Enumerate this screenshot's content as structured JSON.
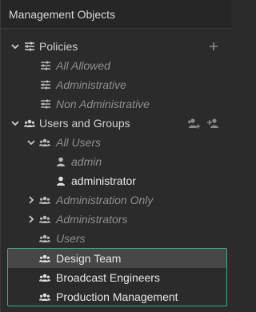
{
  "panel": {
    "title": "Management Objects"
  },
  "tree": {
    "policies": {
      "label": "Policies",
      "icon": "sliders-icon",
      "expanded": true,
      "add_action_icon": "plus-icon",
      "children": [
        {
          "label": "All Allowed",
          "icon": "sliders-icon"
        },
        {
          "label": "Administrative",
          "icon": "sliders-icon"
        },
        {
          "label": "Non Administrative",
          "icon": "sliders-icon"
        }
      ]
    },
    "users_and_groups": {
      "label": "Users and Groups",
      "icon": "group-icon",
      "expanded": true,
      "add_user_icon": "add-user-icon",
      "add_group_icon": "add-group-icon",
      "all_users": {
        "label": "All Users",
        "icon": "group-icon",
        "expanded": true,
        "children": [
          {
            "label": "admin",
            "icon": "user-icon"
          },
          {
            "label": "administrator",
            "icon": "user-icon"
          }
        ]
      },
      "groups": [
        {
          "label": "Administration Only",
          "icon": "group-icon",
          "expandable": true
        },
        {
          "label": "Administrators",
          "icon": "group-icon",
          "expandable": true
        },
        {
          "label": "Users",
          "icon": "group-icon",
          "expandable": false
        },
        {
          "label": "Design Team",
          "icon": "group-icon",
          "expandable": false,
          "selected": true
        },
        {
          "label": "Broadcast Engineers",
          "icon": "group-icon",
          "expandable": false
        },
        {
          "label": "Production Management",
          "icon": "group-icon",
          "expandable": false
        }
      ]
    }
  },
  "colors": {
    "background": "#2b2b2b",
    "header_background": "#262626",
    "selection_border": "#3aa78a",
    "selected_row": "#474747",
    "text_bright": "#e6e6e6",
    "text_muted": "#8e8e8e"
  }
}
